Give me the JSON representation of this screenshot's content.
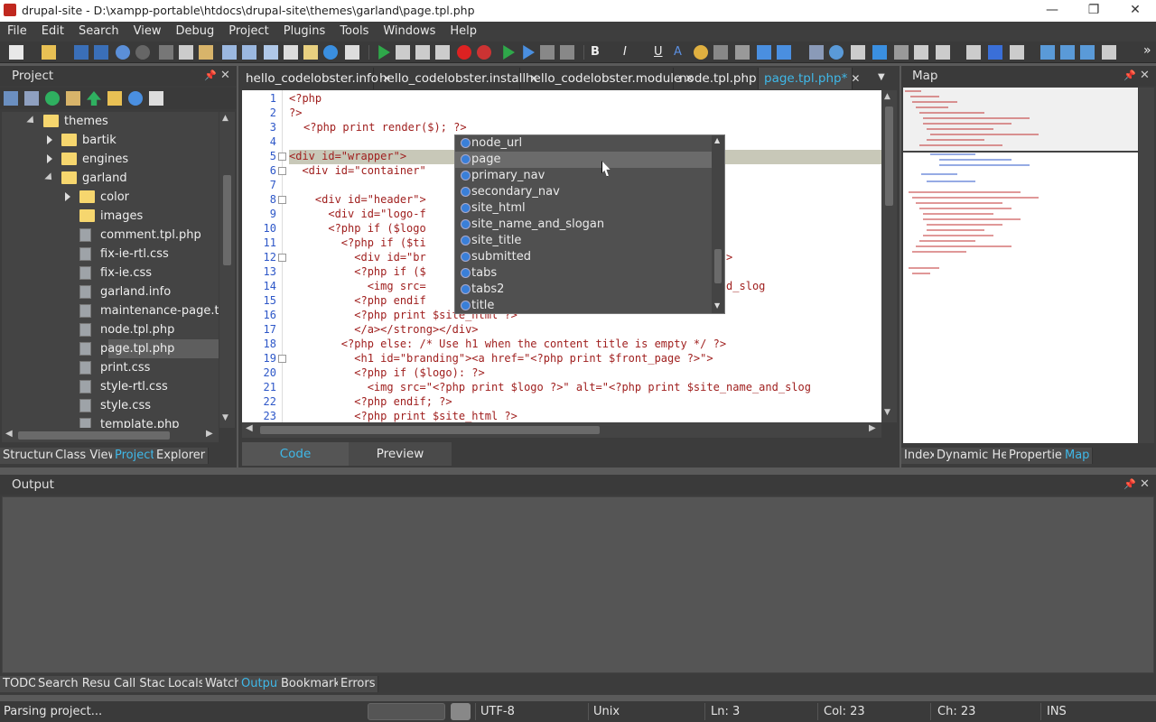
{
  "window": {
    "title": "drupal-site - D:\\xampp-portable\\htdocs\\drupal-site\\themes\\garland\\page.tpl.php",
    "min": "—",
    "max": "❐",
    "close": "✕"
  },
  "menu": [
    "File",
    "Edit",
    "Search",
    "View",
    "Debug",
    "Project",
    "Plugins",
    "Tools",
    "Windows",
    "Help"
  ],
  "project_panel": {
    "title": "Project",
    "tree": [
      {
        "label": "themes",
        "type": "folder",
        "level": 0,
        "expanded": true
      },
      {
        "label": "bartik",
        "type": "folder",
        "level": 1,
        "expanded": false
      },
      {
        "label": "engines",
        "type": "folder",
        "level": 1,
        "expanded": false
      },
      {
        "label": "garland",
        "type": "folder",
        "level": 1,
        "expanded": true
      },
      {
        "label": "color",
        "type": "folder",
        "level": 2,
        "expanded": false
      },
      {
        "label": "images",
        "type": "folder",
        "level": 2,
        "expanded": null
      },
      {
        "label": "comment.tpl.php",
        "type": "file",
        "level": 2
      },
      {
        "label": "fix-ie-rtl.css",
        "type": "file",
        "level": 2
      },
      {
        "label": "fix-ie.css",
        "type": "file",
        "level": 2
      },
      {
        "label": "garland.info",
        "type": "file",
        "level": 2
      },
      {
        "label": "maintenance-page.tpl.p",
        "type": "file",
        "level": 2
      },
      {
        "label": "node.tpl.php",
        "type": "file",
        "level": 2
      },
      {
        "label": "page.tpl.php",
        "type": "file",
        "level": 2,
        "selected": true
      },
      {
        "label": "print.css",
        "type": "file",
        "level": 2
      },
      {
        "label": "style-rtl.css",
        "type": "file",
        "level": 2
      },
      {
        "label": "style.css",
        "type": "file",
        "level": 2
      },
      {
        "label": "template.php",
        "type": "file",
        "level": 2
      }
    ],
    "tabs": [
      "Structure",
      "Class View",
      "Project",
      "Explorer"
    ],
    "active_tab": "Project"
  },
  "editor": {
    "tabs": [
      {
        "label": "hello_codelobster.info",
        "active": false
      },
      {
        "label": "hello_codelobster.install",
        "active": false
      },
      {
        "label": "hello_codelobster.module",
        "active": false
      },
      {
        "label": "node.tpl.php",
        "active": false
      },
      {
        "label": "page.tpl.php*",
        "active": true
      }
    ],
    "lines": [
      "<?php",
      "?>",
      "<?php print render($); ?>",
      "",
      "<div id=\"wrapper\">",
      "  <div id=\"container\"",
      "",
      "    <div id=\"header\">",
      "      <div id=\"logo-f",
      "      <?php if ($logo",
      "        <?php if ($ti",
      "          <div id=\"br                               $front_page ?>\">",
      "          <?php if ($",
      "            <img src=                              nt $site_name_and_slog",
      "          <?php endif",
      "          <?php print $site_html ?>",
      "          </a></strong></div>",
      "        <?php else: /* Use h1 when the content title is empty */ ?>",
      "          <h1 id=\"branding\"><a href=\"<?php print $front_page ?>\">",
      "          <?php if ($logo): ?>",
      "            <img src=\"<?php print $logo ?>\" alt=\"<?php print $site_name_and_slog",
      "          <?php endif; ?>",
      "          <?php print $site_html ?>"
    ],
    "autocomplete": [
      "node_url",
      "page",
      "primary_nav",
      "secondary_nav",
      "site_html",
      "site_name_and_slogan",
      "site_title",
      "submitted",
      "tabs",
      "tabs2",
      "title"
    ],
    "autocomplete_selected": 1,
    "view_tabs": [
      "Code",
      "Preview"
    ],
    "active_view": "Code"
  },
  "map_panel": {
    "title": "Map",
    "tabs": [
      "Index",
      "Dynamic Help",
      "Properties",
      "Map"
    ],
    "active_tab": "Map"
  },
  "output_panel": {
    "title": "Output",
    "tabs": [
      "TODO",
      "Search Result",
      "Call Stack",
      "Locals",
      "Watch",
      "Output",
      "Bookmarks",
      "Errors"
    ],
    "active_tab": "Output"
  },
  "status": {
    "message": "Parsing project...",
    "encoding": "UTF-8",
    "eol": "Unix",
    "line": "Ln: 3",
    "col": "Col: 23",
    "ch": "Ch: 23",
    "mode": "INS"
  },
  "colors": {
    "accent": "#3fb8e8",
    "keyword": "#a0201f",
    "line_numbers": "#2d57c8"
  }
}
